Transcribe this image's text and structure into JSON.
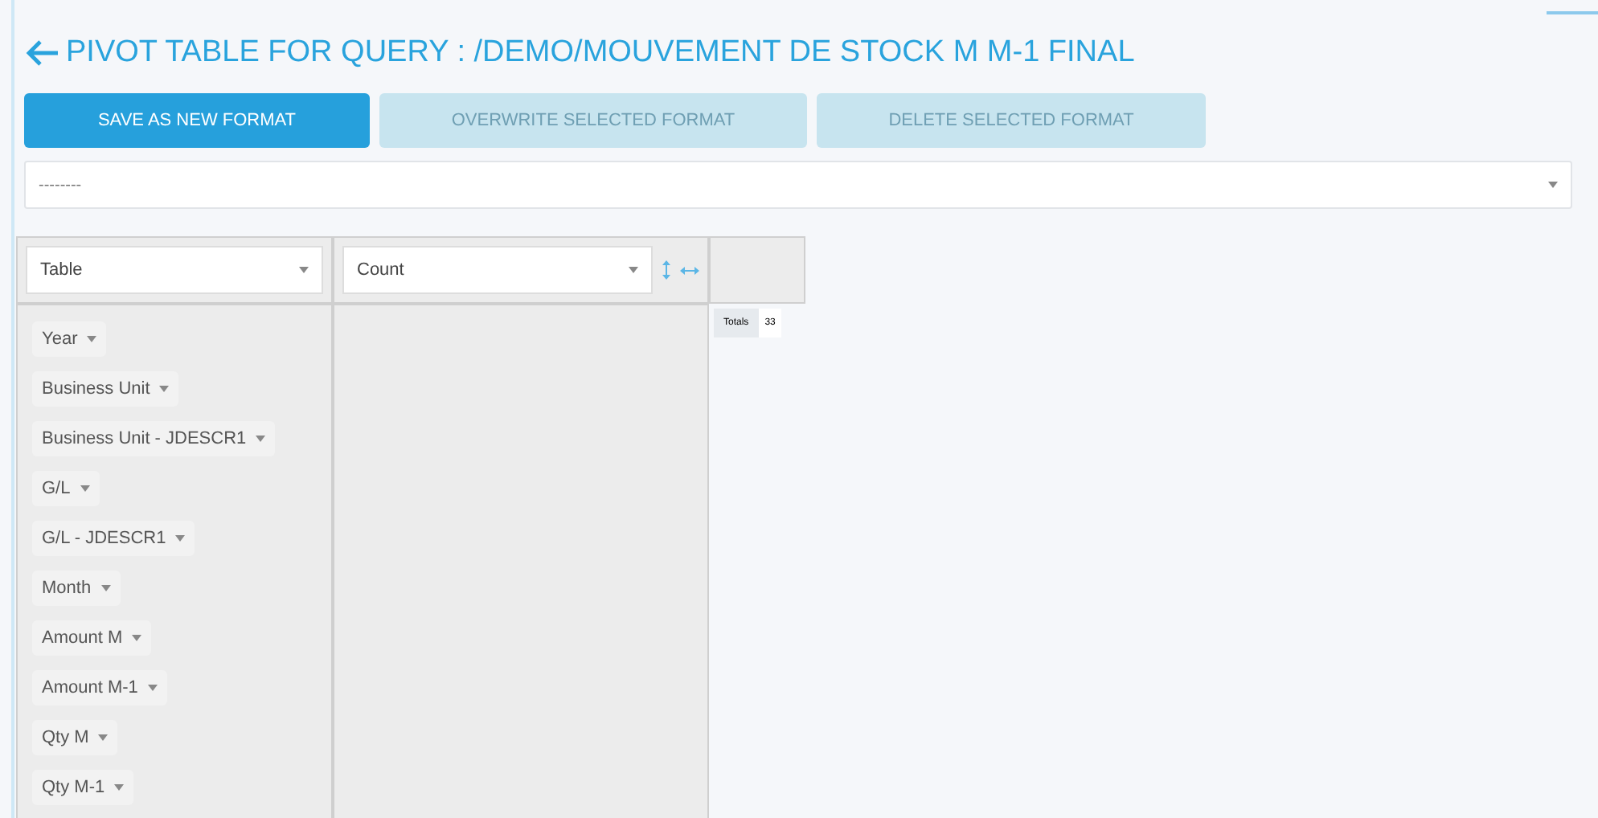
{
  "title": "PIVOT TABLE FOR QUERY : /DEMO/MOUVEMENT DE STOCK M M-1 FINAL",
  "buttons": [
    {
      "label": "SAVE AS NEW FORMAT",
      "disabled": false
    },
    {
      "label": "OVERWRITE SELECTED FORMAT",
      "disabled": true
    },
    {
      "label": "DELETE SELECTED FORMAT",
      "disabled": true
    }
  ],
  "format_select": {
    "value": "--------"
  },
  "renderer_select": {
    "value": "Table"
  },
  "aggregator_select": {
    "value": "Count"
  },
  "fields": [
    "Year",
    "Business Unit",
    "Business Unit - JDESCR1",
    "G/L",
    "G/L - JDESCR1",
    "Month",
    "Amount M",
    "Amount M-1",
    "Qty M",
    "Qty M-1"
  ],
  "totals": {
    "label": "Totals",
    "value": "33"
  }
}
